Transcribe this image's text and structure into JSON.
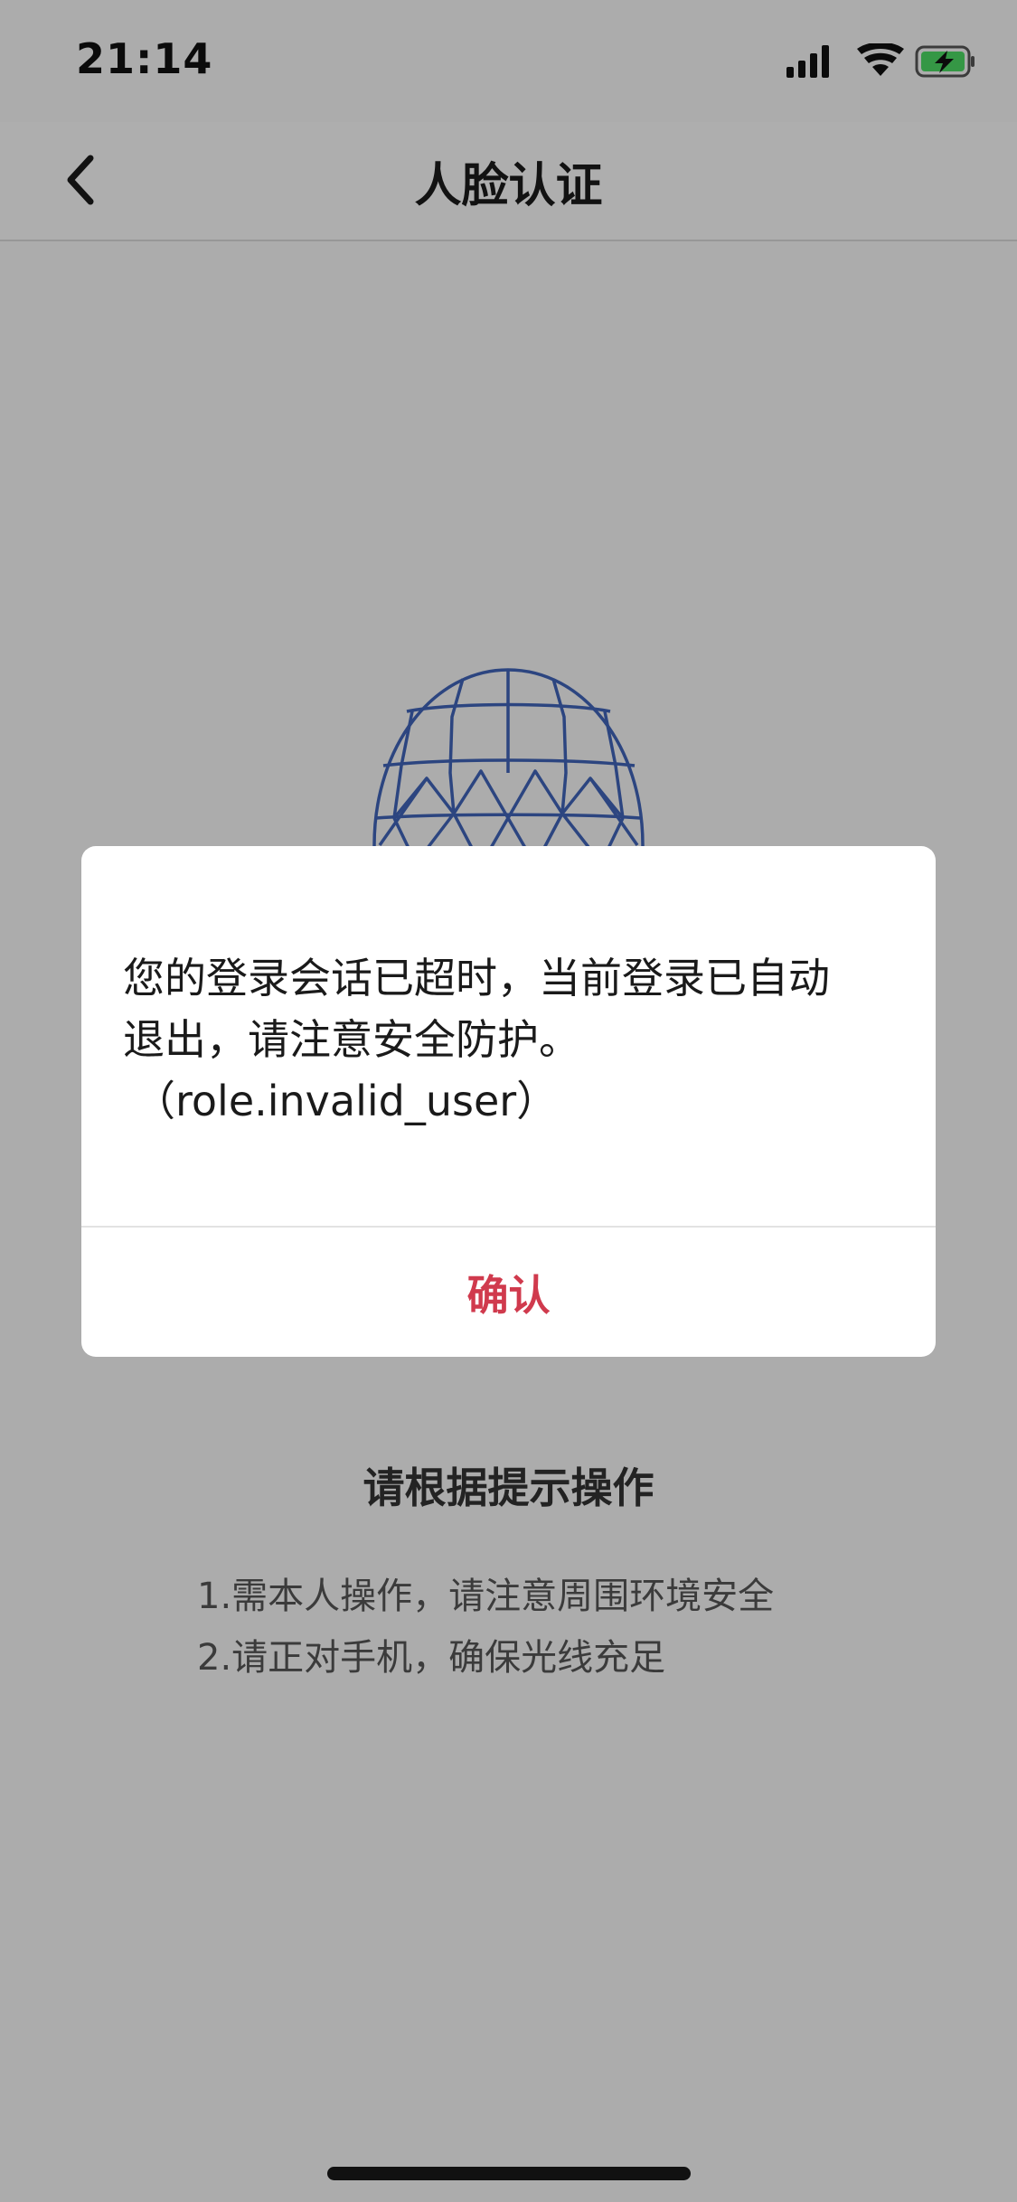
{
  "status_bar": {
    "time": "21:14",
    "icons": [
      "signal-icon",
      "wifi-icon",
      "battery-charging-icon"
    ],
    "battery_color": "#4cd964"
  },
  "nav": {
    "back_icon": "chevron-left-icon",
    "title": "人脸认证"
  },
  "face_illustration": {
    "icon": "face-mesh-icon",
    "color": "#3f63b8"
  },
  "dialog": {
    "message_line1": "您的登录会话已超时，当前登录已自动",
    "message_line2": "退出，请注意安全防护。",
    "error_code": "（role.invalid_user）",
    "confirm_label": "确认",
    "confirm_color": "#d03a4d"
  },
  "instructions": {
    "title": "请根据提示操作",
    "items": [
      "1.需本人操作，请注意周围环境安全",
      "2.请正对手机，确保光线充足"
    ]
  }
}
